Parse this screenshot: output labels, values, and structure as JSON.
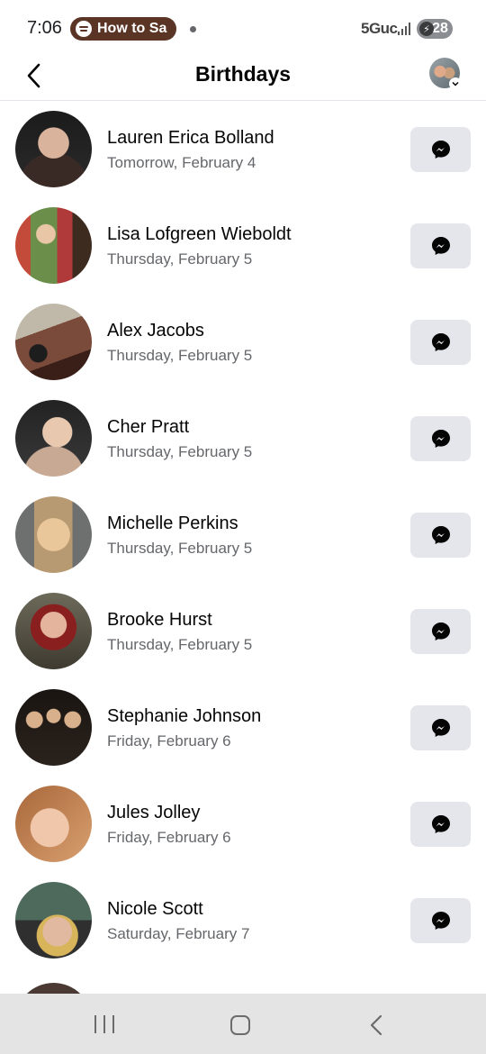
{
  "status_bar": {
    "time": "7:06",
    "media_pill": "How to Sa",
    "network": "5Guc",
    "battery": "28"
  },
  "header": {
    "title": "Birthdays",
    "back_icon": "chevron-left-icon",
    "profile_icon": "avatar"
  },
  "birthdays": [
    {
      "name": "Lauren Erica Bolland",
      "date": "Tomorrow, February 4",
      "avatar_colors": [
        "#1b1b1b",
        "#d9b39b"
      ]
    },
    {
      "name": "Lisa Lofgreen Wieboldt",
      "date": "Thursday, February 5",
      "avatar_colors": [
        "#6b8f4a",
        "#c24b3a"
      ]
    },
    {
      "name": "Alex Jacobs",
      "date": "Thursday, February 5",
      "avatar_colors": [
        "#7a4a3a",
        "#c0b8a8"
      ]
    },
    {
      "name": "Cher Pratt",
      "date": "Thursday, February 5",
      "avatar_colors": [
        "#222222",
        "#e8c9b0"
      ]
    },
    {
      "name": "Michelle Perkins",
      "date": "Thursday, February 5",
      "avatar_colors": [
        "#6e6f6f",
        "#e9c79a"
      ]
    },
    {
      "name": "Brooke Hurst",
      "date": "Thursday, February 5",
      "avatar_colors": [
        "#8a1f1f",
        "#e4b59c"
      ]
    },
    {
      "name": "Stephanie Johnson",
      "date": "Friday, February 6",
      "avatar_colors": [
        "#1a1512",
        "#d8b08c"
      ]
    },
    {
      "name": "Jules Jolley",
      "date": "Friday, February 6",
      "avatar_colors": [
        "#a8673a",
        "#f0c7aa"
      ]
    },
    {
      "name": "Nicole Scott",
      "date": "Saturday, February 7",
      "avatar_colors": [
        "#4e6a5c",
        "#e0b9a0"
      ]
    }
  ],
  "colors": {
    "button_bg": "#e4e6eb",
    "secondary_text": "#65676b"
  }
}
